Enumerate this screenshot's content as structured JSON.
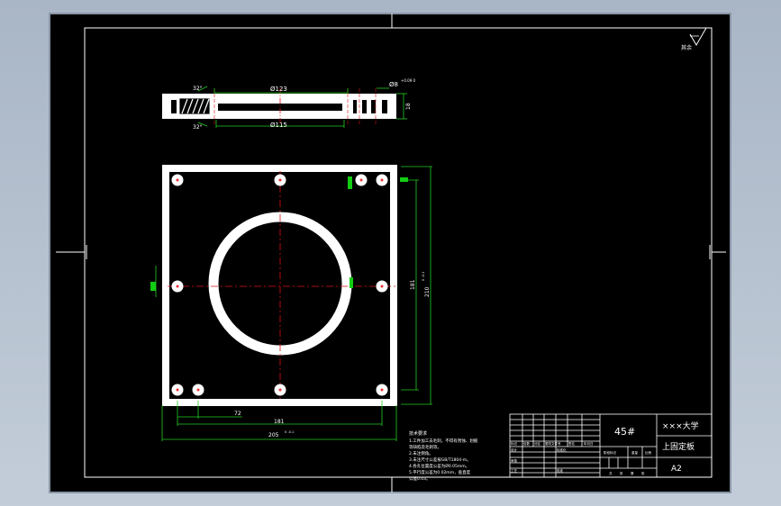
{
  "drawing": {
    "part_name": "上固定板",
    "material": "45#",
    "school": "×××大学",
    "sheet_size": "A2",
    "roughness_note": "其余"
  },
  "section_view": {
    "dims": {
      "dia_top": "Ø123",
      "dia_bottom": "Ø115",
      "chamfer_top": "32°",
      "chamfer_bottom": "32°",
      "bore_dia": "Ø8",
      "bore_tol": "+0.09 0",
      "thickness": "18"
    }
  },
  "plan_view": {
    "dims": {
      "pitch": "72",
      "span": "181",
      "width_total": "205",
      "width_tol": "0 -0.1",
      "height_inner": "181",
      "height_total": "210",
      "height_tol": "0 -0.1"
    }
  },
  "tech_notes": {
    "title": "技术要求",
    "lines": [
      "1.工件加工去毛刺，不得有锈蚀、划痕",
      "  等缺陷及毛刺等。",
      "2.未注倒角。",
      "3.未注尺寸公差按GB/T1804-m。",
      "4.各孔位置度公差为Ø0.05mm。",
      "5.平行度公差为0.02mm，垂直度",
      "  公差0.03。"
    ]
  },
  "title_block": {
    "row_labels": [
      "标记",
      "处数",
      "分区",
      "更改文件号",
      "签名",
      "年月日"
    ],
    "sign_labels": [
      "设计",
      "审核",
      "工艺",
      "标准化",
      "批准"
    ],
    "stage_labels": [
      "阶段标记",
      "重量",
      "比例"
    ],
    "sheet_labels": [
      "共",
      "张",
      "第",
      "张"
    ]
  }
}
